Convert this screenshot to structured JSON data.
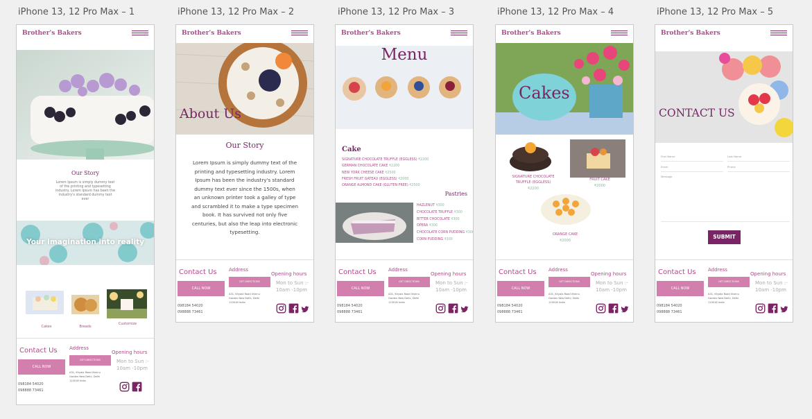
{
  "artboards": [
    {
      "title": "iPhone 13, 12 Pro Max – 1"
    },
    {
      "title": "iPhone 13, 12 Pro Max – 2"
    },
    {
      "title": "iPhone 13, 12 Pro Max – 3"
    },
    {
      "title": "iPhone 13, 12 Pro Max – 4"
    },
    {
      "title": "iPhone 13, 12 Pro Max – 5"
    }
  ],
  "brand": "Brother's Bakers",
  "home": {
    "story_title": "Our Story",
    "story_text": "Lorem Ipsum is simply dummy text of the printing and typesetting industry. Lorem Ipsum has been the industry's standard dummy text ever",
    "banner": "Your imagination into reality",
    "categories": [
      "Cakes",
      "Breads",
      "Customize"
    ]
  },
  "about": {
    "heading": "About Us",
    "story_title": "Our Story",
    "story_text": "Lorem Ipsum is simply dummy text of the printing and typesetting industry. Lorem Ipsum has been the industry's standard dummy text ever since the 1500s, when an unknown printer took a galley of type and scrambled it to make a type specimen book. It has survived not only five centuries, but also the leap into electronic typesetting."
  },
  "menu": {
    "heading": "Menu",
    "cake_title": "Cake",
    "cakes": [
      {
        "name": "SIGNATURE CHOCOLATE TRUFFLE (EGGLESS)",
        "price": "₹2200"
      },
      {
        "name": "GERMAN CHOCOLATE CAKE",
        "price": "₹2200"
      },
      {
        "name": "NEW YORK CHEESE CAKE",
        "price": "₹2500"
      },
      {
        "name": "FRESH FRUIT GATEAU (EGGLESS)",
        "price": "₹2000"
      },
      {
        "name": "ORANGE ALMOND CAKE (GLUTEN FREE)",
        "price": "₹2500"
      }
    ],
    "pastries_title": "Pastries",
    "pastries": [
      {
        "name": "HAZLENUT",
        "price": "₹300"
      },
      {
        "name": "CHOCOLATE TRUFFLE",
        "price": "₹300"
      },
      {
        "name": "BITTER CHOCOLATE",
        "price": "₹300"
      },
      {
        "name": "OPERA",
        "price": "₹300"
      },
      {
        "name": "CHOCOLATE CORN PUDDING",
        "price": "₹300"
      },
      {
        "name": "CORN PUDDING",
        "price": "₹300"
      }
    ]
  },
  "cakes": {
    "heading": "Cakes",
    "items": [
      {
        "name": "SIGNATURE CHOCOLATE TRUFFLE (EGGLESS)",
        "price": "₹2200"
      },
      {
        "name": "FRUIT CAKE",
        "price": "₹2000"
      },
      {
        "name": "ORANGE CAKE",
        "price": "₹2000"
      }
    ]
  },
  "contact": {
    "heading": "CONTACT US",
    "placeholders": [
      "First Name",
      "Last Name",
      "Email",
      "Phone",
      "Message"
    ],
    "submit": "SUBMIT"
  },
  "footer": {
    "contact_title": "Contact Us",
    "call": "CALL NOW",
    "phones": [
      "098184 54020",
      "098888 73461"
    ],
    "address_title": "Address",
    "directions": "GET DIRECTIONS",
    "address": "A31, Khyala Road Vishnu Garden New Delhi, Delhi 110018 India",
    "hours_title": "Opening hours",
    "hours_days": "Mon to Sun :-",
    "hours_time": "10am -10pm"
  }
}
